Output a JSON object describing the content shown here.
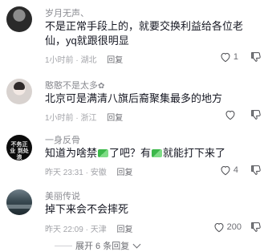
{
  "comments": [
    {
      "username": "岁月无声、",
      "text": "不是正常手段上的，就要交换利益给各位老仙，yq就跟很明显",
      "time": "1小时前",
      "location": "湖北",
      "reply_label": "回复",
      "likes": "1"
    },
    {
      "username": "憨憨不是太多",
      "text": "北京可是满清八旗后裔聚集最多的地方",
      "time": "1小时前",
      "location": "浙江",
      "reply_label": "回复",
      "likes": ""
    },
    {
      "username": "一身反骨",
      "avatar_text": "不务正业 到处浪",
      "text_part1": "知道为啥禁",
      "text_part2": "了吧？有",
      "text_part3": "就能打下来了",
      "time": "昨天 23:31",
      "location": "安徽",
      "reply_label": "回复",
      "likes": "4"
    },
    {
      "username": "美丽传说",
      "text": "掉下来会不会摔死",
      "time": "昨天 22:09",
      "location": "天津",
      "reply_label": "回复",
      "likes": "200"
    }
  ],
  "expand_label": "展开 6 条回复",
  "icons": {
    "like": "heart-outline-icon",
    "dislike": "thumbs-down-outline-icon",
    "expand": "chevron-down-icon"
  }
}
